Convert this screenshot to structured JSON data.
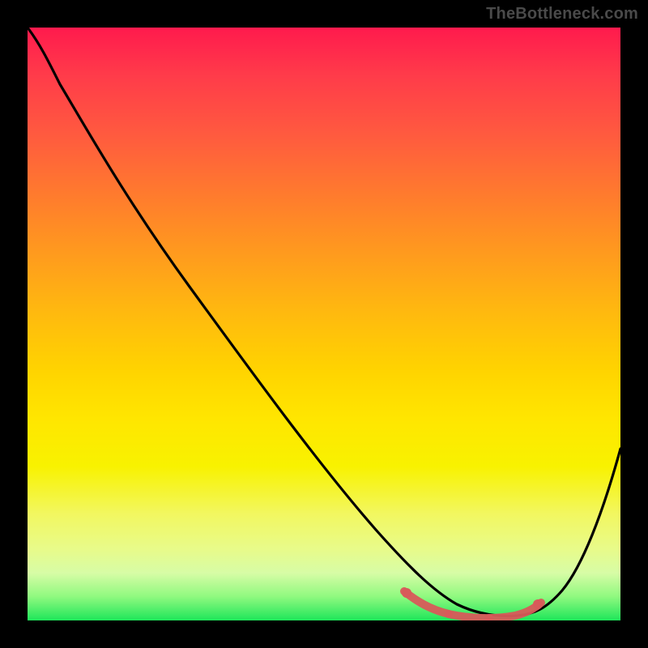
{
  "watermark": "TheBottleneck.com",
  "chart_data": {
    "type": "line",
    "title": "",
    "xlabel": "",
    "ylabel": "",
    "xlim": [
      0,
      100
    ],
    "ylim": [
      0,
      100
    ],
    "series": [
      {
        "name": "bottleneck-curve",
        "x": [
          0,
          4,
          10,
          20,
          30,
          40,
          50,
          58,
          62,
          66,
          70,
          74,
          78,
          82,
          86,
          90,
          96,
          100
        ],
        "values": [
          100,
          96,
          90,
          80,
          68,
          55,
          42,
          30,
          22,
          14,
          8,
          4,
          2,
          2,
          3,
          6,
          18,
          30
        ]
      },
      {
        "name": "highlight-band",
        "x": [
          62,
          66,
          70,
          74,
          78,
          82,
          84
        ],
        "values": [
          5,
          3,
          2,
          2,
          2,
          3,
          4
        ]
      }
    ],
    "background_gradient": {
      "top_color": "#ff1a4d",
      "bottom_color": "#1ee65a",
      "description": "red-to-green vertical heat gradient"
    }
  }
}
